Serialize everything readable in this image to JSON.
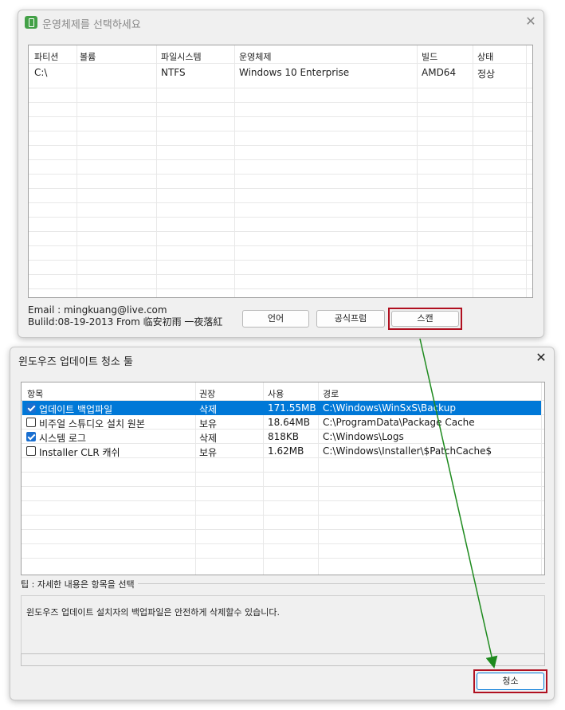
{
  "window1": {
    "title": "운영체제를 선택하세요",
    "close_glyph": "✕",
    "columns": [
      "파티션",
      "볼륨",
      "파일시스템",
      "운영체제",
      "빌드",
      "상태"
    ],
    "rows": [
      [
        "C:\\",
        "",
        "NTFS",
        "Windows 10 Enterprise",
        "AMD64",
        "정상"
      ]
    ],
    "info": {
      "email": "Email : mingkuang@live.com",
      "build": "Bulild:08-19-2013 From 临安初雨 一夜落紅"
    },
    "buttons": {
      "language": "언어",
      "official_site": "공식프럼",
      "scan": "스캔"
    }
  },
  "window2": {
    "title": "윈도우즈 업데이트 청소 툴",
    "close_glyph": "✕",
    "columns": [
      "항목",
      "권장",
      "사용",
      "경로"
    ],
    "rows": [
      {
        "checked": true,
        "selected": true,
        "name": "업데이트 백업파일",
        "rec": "삭제",
        "size": "171.55MB",
        "path": "C:\\Windows\\WinSxS\\Backup"
      },
      {
        "checked": false,
        "selected": false,
        "name": "비주얼 스튜디오 설치 원본",
        "rec": "보유",
        "size": "18.64MB",
        "path": "C:\\ProgramData\\Package Cache"
      },
      {
        "checked": true,
        "selected": false,
        "name": "시스템 로그",
        "rec": "삭제",
        "size": "818KB",
        "path": "C:\\Windows\\Logs"
      },
      {
        "checked": false,
        "selected": false,
        "name": "Installer CLR 캐쉬",
        "rec": "보유",
        "size": "1.62MB",
        "path": "C:\\Windows\\Installer\\$PatchCache$"
      }
    ],
    "tip_label": "팁 : 자세한 내용은 항목을 선택",
    "tip_text": "윈도우즈 업데이트 설치자의 백업파일은 안전하게 삭제할수 있습니다.",
    "clean_button": "청소"
  },
  "colors": {
    "highlight_box": "#b01020",
    "arrow": "#1e8a1e",
    "selection": "#0078d7"
  }
}
